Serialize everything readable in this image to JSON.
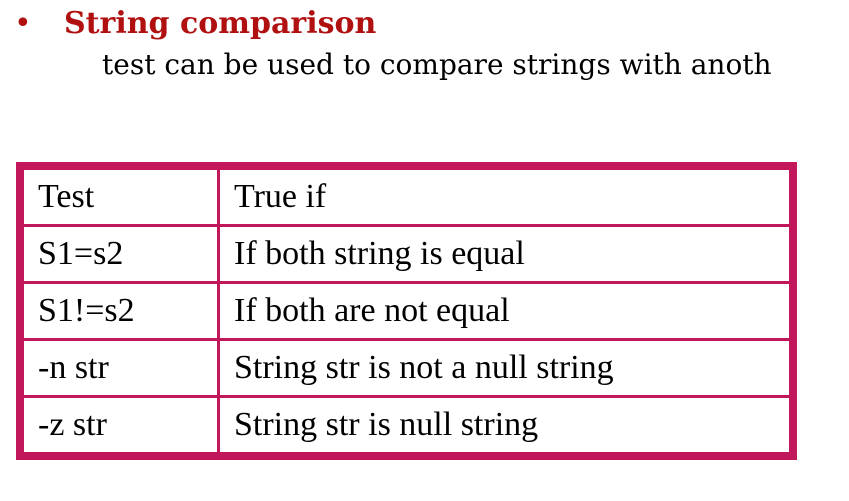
{
  "slide": {
    "bullet": "•",
    "heading": "String comparison",
    "description": "test can be used to compare strings with anoth",
    "heading_color": "#b01010",
    "table_border_color": "#c2185b"
  },
  "table": {
    "header": [
      "Test",
      "True if"
    ],
    "rows": [
      [
        "S1=s2",
        "If both string is equal"
      ],
      [
        "S1!=s2",
        "If both are not equal"
      ],
      [
        "-n str",
        "String str is not a null string"
      ],
      [
        "-z str",
        "String str is null string"
      ]
    ]
  }
}
